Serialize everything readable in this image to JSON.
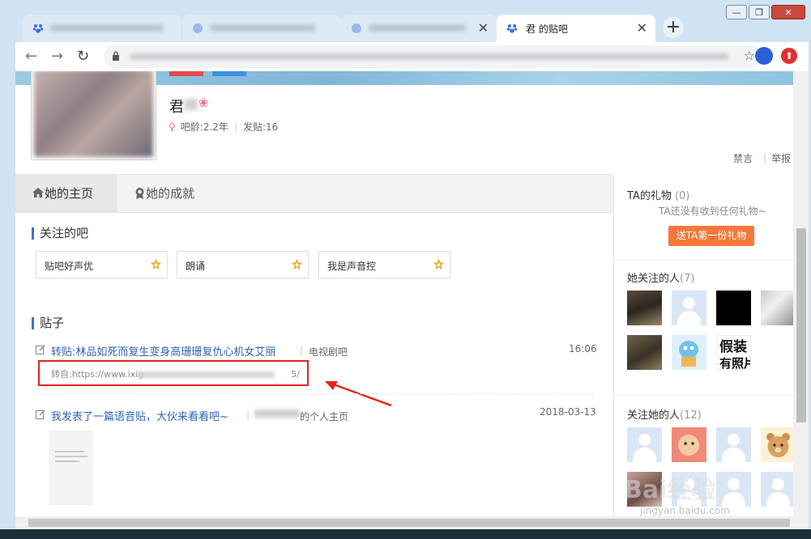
{
  "browser": {
    "tabs": [
      {
        "title": "",
        "active": false
      },
      {
        "title": "",
        "active": false
      },
      {
        "title": "",
        "active": false
      },
      {
        "title": "君  的贴吧",
        "active": true
      }
    ],
    "new_tab": "+",
    "window": {
      "minimize": "—",
      "maximize": "❐",
      "close": "✕"
    },
    "nav": {
      "back": "←",
      "forward": "→",
      "reload": "↻"
    },
    "address": "",
    "bookmark": "☆",
    "ext_upload": "⬆"
  },
  "profile": {
    "name": "君",
    "flower": "❀",
    "gender_icon": "♀",
    "age": "吧龄:2.2年",
    "posts": "发贴:16",
    "mute": "禁言",
    "report": "举报"
  },
  "page_tabs": {
    "home": "她的主页",
    "achievements": "她的成就"
  },
  "follows": {
    "title": "关注的吧",
    "bars": [
      {
        "name": "贴吧好声优"
      },
      {
        "name": "朗诵"
      },
      {
        "name": "我是声音控"
      }
    ]
  },
  "posts": {
    "title": "贴子",
    "items": [
      {
        "title": "转贴:林品如死而复生变身高珊珊复仇心机女艾丽",
        "source": "电视剧吧",
        "time": "16:06",
        "quote_prefix": "转自:https://www.ixig",
        "quote_suffix": "5/"
      },
      {
        "title": "我发表了一篇语音贴，大伙来看看吧~",
        "source": "的个人主页",
        "time": "2018-03-13"
      }
    ]
  },
  "sidebar": {
    "gifts": {
      "title": "TA的礼物",
      "count": "(0)",
      "note": "TA还没有收到任何礼物~",
      "button": "送TA第一份礼物"
    },
    "following": {
      "title": "她关注的人",
      "count": "(7)"
    },
    "followers": {
      "title": "关注她的人",
      "count": "(12)"
    }
  },
  "watermark": {
    "main": "Bai经验",
    "sub": "jingyan.baidu.com"
  },
  "colors": {
    "accent_blue": "#2d64b3",
    "gift_orange": "#f7783a",
    "highlight_red": "#e0251b"
  }
}
